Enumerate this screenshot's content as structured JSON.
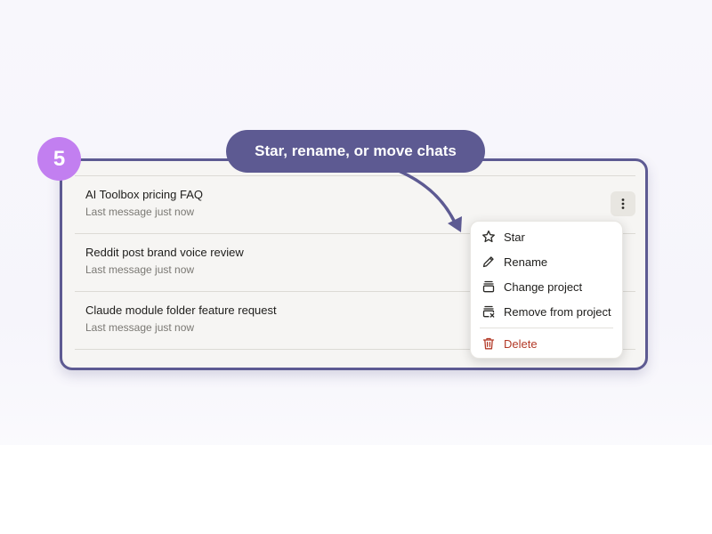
{
  "step_badge": {
    "number": "5"
  },
  "callout": {
    "text": "Star, rename, or move chats"
  },
  "chats": [
    {
      "title": "AI Toolbox pricing FAQ",
      "meta": "Last message just now"
    },
    {
      "title": "Reddit post brand voice review",
      "meta": "Last message just now"
    },
    {
      "title": "Claude module folder feature request",
      "meta": "Last message just now"
    }
  ],
  "menu": {
    "items": [
      {
        "label": "Star",
        "icon": "star-icon"
      },
      {
        "label": "Rename",
        "icon": "pencil-icon"
      },
      {
        "label": "Change project",
        "icon": "project-icon"
      },
      {
        "label": "Remove from project",
        "icon": "remove-project-icon"
      }
    ],
    "delete": {
      "label": "Delete",
      "icon": "trash-icon"
    }
  },
  "colors": {
    "accent_frame": "#5d5a92",
    "badge": "#c27ff0",
    "danger": "#b33a28"
  }
}
